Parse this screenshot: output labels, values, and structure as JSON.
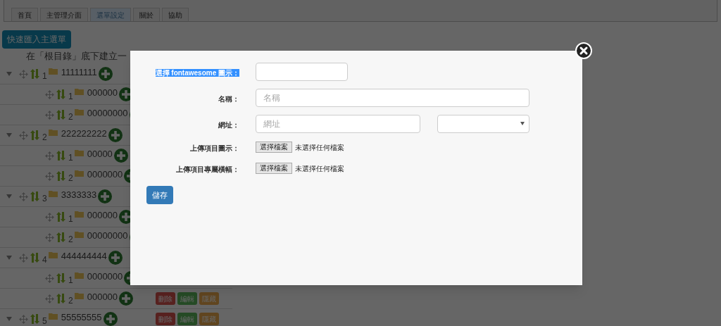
{
  "tabs": [
    {
      "label": "首頁",
      "selected": false
    },
    {
      "label": "主管理介面",
      "selected": false
    },
    {
      "label": "選單設定",
      "selected": true
    },
    {
      "label": "關於",
      "selected": false
    },
    {
      "label": "協助",
      "selected": false
    }
  ],
  "import_button": "快速匯入主選單",
  "tree_header": "在「根目錄」底下建立一",
  "tree": [
    {
      "number": "1",
      "name": "11111111",
      "expanded": true,
      "children": [
        {
          "number": "1",
          "name": "000000"
        },
        {
          "number": "2",
          "name": "00000000"
        }
      ]
    },
    {
      "number": "2",
      "name": "222222222",
      "expanded": true,
      "children": [
        {
          "number": "1",
          "name": "00000"
        },
        {
          "number": "2",
          "name": "0000000"
        }
      ]
    },
    {
      "number": "3",
      "name": "3333333",
      "expanded": true,
      "children": [
        {
          "number": "1",
          "name": "000000"
        },
        {
          "number": "2",
          "name": "00000000"
        }
      ]
    },
    {
      "number": "4",
      "name": "444444444",
      "expanded": true,
      "children": [
        {
          "number": "1",
          "name": "0000000"
        },
        {
          "number": "2",
          "name": "000000",
          "actions": [
            {
              "kind": "delete",
              "label": "刪除"
            },
            {
              "kind": "edit",
              "label": "編輯"
            },
            {
              "kind": "hide",
              "label": "隱藏"
            }
          ]
        }
      ]
    },
    {
      "number": "5",
      "name": "55555555",
      "expanded": true,
      "actions": [
        {
          "kind": "delete",
          "label": "刪除"
        },
        {
          "kind": "edit",
          "label": "編輯"
        },
        {
          "kind": "hide",
          "label": "隱藏"
        }
      ]
    }
  ],
  "modal": {
    "fields": [
      {
        "kind": "text",
        "label": "選擇 fontawesome 圖示：",
        "highlighted": true
      },
      {
        "kind": "wide_text",
        "label": "名稱：",
        "placeholder": "名稱",
        "highlighted": false
      },
      {
        "kind": "text_select",
        "label": "網址：",
        "placeholder": "網址",
        "highlighted": false
      },
      {
        "kind": "file",
        "label": "上傳項目圖示：",
        "button": "選擇檔案",
        "status": "未選擇任何檔案",
        "highlighted": false
      },
      {
        "kind": "file",
        "label": "上傳項目專屬橫幅：",
        "button": "選擇檔案",
        "status": "未選擇任何檔案",
        "highlighted": false
      }
    ],
    "save_button": "儲存"
  }
}
